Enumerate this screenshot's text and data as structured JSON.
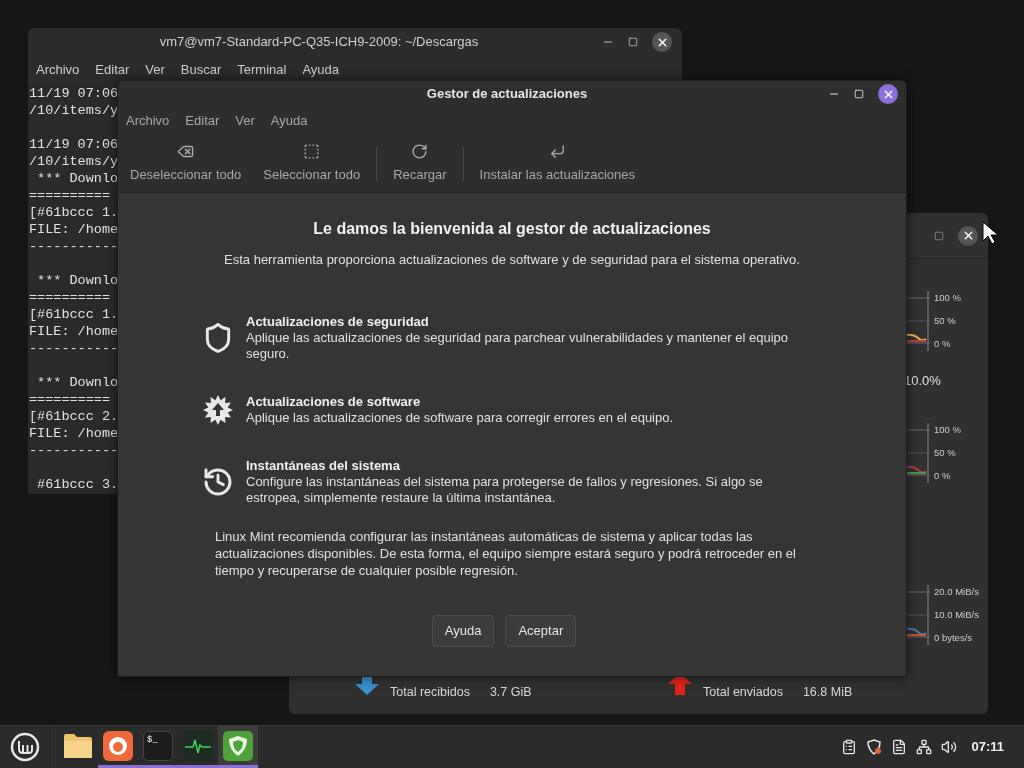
{
  "terminal": {
    "title": "vm7@vm7-Standard-PC-Q35-ICH9-2009: ~/Descargas",
    "menu": [
      "Archivo",
      "Editar",
      "Ver",
      "Buscar",
      "Terminal",
      "Ayuda"
    ],
    "lines": [
      {
        "kind": "text",
        "text": "11/19 07:06"
      },
      {
        "kind": "text",
        "text": "/10/items/y"
      },
      {
        "kind": "blank"
      },
      {
        "kind": "text",
        "text": "11/19 07:06"
      },
      {
        "kind": "text",
        "text": "/10/items/y"
      },
      {
        "kind": "text",
        "text": " *** Downlo"
      },
      {
        "kind": "text",
        "text": "=========="
      },
      {
        "kind": "text",
        "text": "[#61bccc 1."
      },
      {
        "kind": "text",
        "text": "FILE: /home"
      },
      {
        "kind": "text",
        "text": "-----------"
      },
      {
        "kind": "blank"
      },
      {
        "kind": "text",
        "text": " *** Downlo"
      },
      {
        "kind": "text",
        "text": "=========="
      },
      {
        "kind": "text",
        "text": "[#61bccc 1."
      },
      {
        "kind": "text",
        "text": "FILE: /home"
      },
      {
        "kind": "text",
        "text": "-----------"
      },
      {
        "kind": "blank"
      },
      {
        "kind": "text",
        "text": " *** Downlo"
      },
      {
        "kind": "text",
        "text": "=========="
      },
      {
        "kind": "text",
        "text": "[#61bccc 2."
      },
      {
        "kind": "text",
        "text": "FILE: /home"
      },
      {
        "kind": "text",
        "text": "-----------"
      },
      {
        "kind": "blank"
      },
      {
        "kind": "text",
        "text": " #61bccc 3."
      }
    ]
  },
  "update_manager": {
    "title": "Gestor de actualizaciones",
    "menu": [
      "Archivo",
      "Editar",
      "Ver",
      "Ayuda"
    ],
    "toolbar": [
      {
        "kind": "button",
        "label": "Deseleccionar todo"
      },
      {
        "kind": "button",
        "label": "Seleccionar todo"
      },
      {
        "kind": "separator"
      },
      {
        "kind": "button",
        "label": "Recargar"
      },
      {
        "kind": "separator"
      },
      {
        "kind": "button",
        "label": "Instalar las actualizaciones"
      }
    ],
    "heading": "Le damos la bienvenida al gestor de actualizaciones",
    "subtitle": "Esta herramienta proporciona actualizaciones de software y de seguridad para el sistema operativo.",
    "features": [
      {
        "title": "Actualizaciones de seguridad",
        "text": "Aplique las actualizaciones de seguridad para parchear vulnerabilidades y mantener el equipo seguro."
      },
      {
        "title": "Actualizaciones de software",
        "text": "Aplique las actualizaciones de software para corregir errores en el equipo."
      },
      {
        "title": "Instantáneas del sistema",
        "text": "Configure las instantáneas del sistema para protegerse de fallos y regresiones. Si algo se estropea, simplemente restaure la última instantánea."
      }
    ],
    "note": "Linux Mint recomienda configurar las instantáneas automáticas de sistema y aplicar todas las actualizaciones disponibles. De esta forma, el equipo siempre estará seguro y podrá retroceder en el tiempo y recuperarse de cualquier posible regresión.",
    "buttons": [
      "Ayuda",
      "Aceptar"
    ]
  },
  "system_monitor": {
    "cpu_axis": [
      "100 %",
      "50 %",
      "0 %"
    ],
    "cpu_reading": "10.0%",
    "memory_axis": [
      "100 %",
      "50 %",
      "0 %"
    ],
    "network_axis": [
      "20.0 MiB/s",
      "10.0 MiB/s",
      "0 bytes/s"
    ],
    "received": {
      "total_label": "Total recibidos",
      "total_value": "3.7 GiB"
    },
    "sent": {
      "total_label": "Total enviados",
      "total_value": "16.8 MiB"
    }
  },
  "taskbar": {
    "apps": [
      {
        "running": false,
        "selected": false
      },
      {
        "running": true,
        "selected": false
      },
      {
        "glyph": "$_",
        "running": true,
        "selected": false
      },
      {
        "running": true,
        "selected": false
      },
      {
        "running": true,
        "selected": true
      }
    ],
    "clock": "07:11"
  }
}
